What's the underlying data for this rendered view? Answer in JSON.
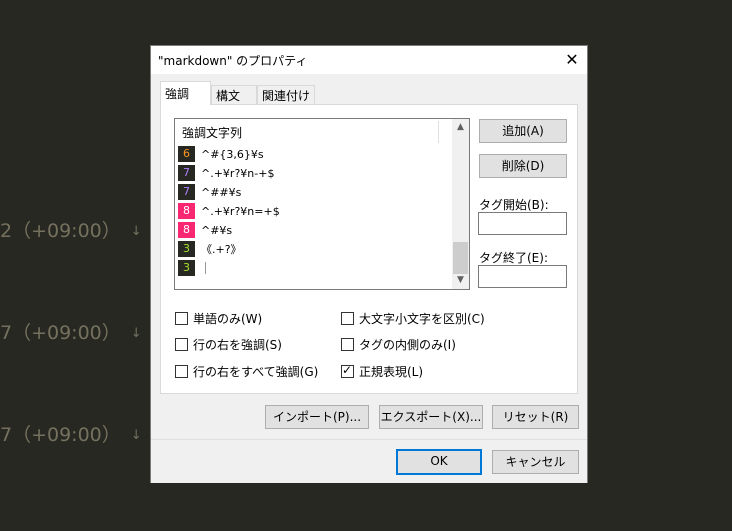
{
  "background": {
    "lines": [
      {
        "text": "2（+09:00）",
        "arrow": "↓"
      },
      {
        "text": "7（+09:00）",
        "arrow": "↓"
      },
      {
        "text": "7（+09:00）",
        "arrow": "↓"
      }
    ]
  },
  "dialog": {
    "title": "\"markdown\" のプロパティ",
    "close_glyph": "✕",
    "tabs": [
      {
        "label": "強調"
      },
      {
        "label": "構文"
      },
      {
        "label": "関連付け"
      }
    ],
    "list": {
      "header": "強調文字列",
      "rows": [
        {
          "color_index": "6",
          "text": "^#{3,6}¥s",
          "bg": "#272822",
          "fg": "#fd971f"
        },
        {
          "color_index": "7",
          "text": "^.+¥r?¥n-+$",
          "bg": "#272822",
          "fg": "#ae81ff"
        },
        {
          "color_index": "7",
          "text": "^##¥s",
          "bg": "#272822",
          "fg": "#ae81ff"
        },
        {
          "color_index": "8",
          "text": "^.+¥r?¥n=+$",
          "bg": "#f92672",
          "fg": "#ffffff"
        },
        {
          "color_index": "8",
          "text": "^#¥s",
          "bg": "#f92672",
          "fg": "#ffffff"
        },
        {
          "color_index": "3",
          "text": "《.+?》",
          "bg": "#272822",
          "fg": "#a6e22e"
        },
        {
          "color_index": "3",
          "text": "",
          "bg": "#272822",
          "fg": "#a6e22e"
        }
      ]
    },
    "buttons": {
      "add": "追加(A)",
      "delete": "削除(D)",
      "import": "インポート(P)...",
      "export": "エクスポート(X)...",
      "reset": "リセット(R)",
      "ok": "OK",
      "cancel": "キャンセル"
    },
    "tag_start_label": "タグ開始(B):",
    "tag_end_label": "タグ終了(E):",
    "tag_start_value": "",
    "tag_end_value": "",
    "checkboxes": [
      {
        "label": "単語のみ(W)",
        "checked": false
      },
      {
        "label": "大文字小文字を区別(C)",
        "checked": false
      },
      {
        "label": "行の右を強調(S)",
        "checked": false
      },
      {
        "label": "タグの内側のみ(I)",
        "checked": false
      },
      {
        "label": "行の右をすべて強調(G)",
        "checked": false
      },
      {
        "label": "正規表現(L)",
        "checked": true
      }
    ],
    "check_glyph": "✓"
  }
}
